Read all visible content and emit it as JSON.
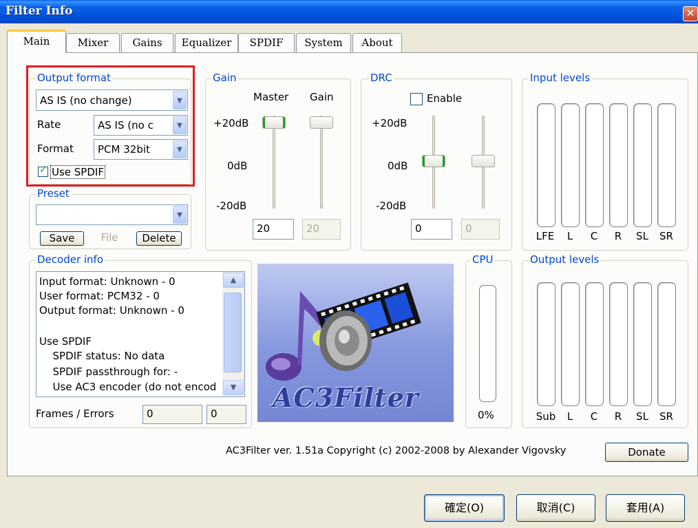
{
  "window": {
    "title": "Filter Info",
    "close_label": "x"
  },
  "tabs": [
    "Main",
    "Mixer",
    "Gains",
    "Equalizer",
    "SPDIF",
    "System",
    "About"
  ],
  "output_format": {
    "label": "Output format",
    "format_value": "AS IS (no change)",
    "rate_label": "Rate",
    "rate_value": "AS IS (no c",
    "format_label": "Format",
    "pcm_value": "PCM 32bit",
    "use_spdif_label": "Use SPDIF",
    "use_spdif_checked": true
  },
  "preset": {
    "label": "Preset",
    "value": "",
    "save": "Save",
    "file": "File",
    "delete": "Delete"
  },
  "gain": {
    "label": "Gain",
    "master_label": "Master",
    "gain_label": "Gain",
    "top_tick": "+20dB",
    "mid_tick": "0dB",
    "bottom_tick": "-20dB",
    "master_value": "20",
    "gain_value": "20"
  },
  "drc": {
    "label": "DRC",
    "enable_label": "Enable",
    "enable_checked": false,
    "top_tick": "+20dB",
    "mid_tick": "0dB",
    "bottom_tick": "-20dB",
    "value1": "0",
    "value2": "0"
  },
  "input_levels": {
    "label": "Input levels",
    "channels": [
      "LFE",
      "L",
      "C",
      "R",
      "SL",
      "SR"
    ]
  },
  "output_levels": {
    "label": "Output levels",
    "channels": [
      "Sub",
      "L",
      "C",
      "R",
      "SL",
      "SR"
    ]
  },
  "decoder_info": {
    "label": "Decoder info",
    "lines": [
      "Input format: Unknown - 0",
      "User format: PCM32 - 0",
      "Output format: Unknown - 0",
      "",
      "Use SPDIF",
      "  SPDIF status: No data",
      "  SPDIF passthrough for: -",
      "  Use AC3 encoder (do not encod"
    ],
    "frames_label": "Frames / Errors",
    "frames_value": "0",
    "errors_value": "0"
  },
  "logo_text": "AC3Filter",
  "cpu": {
    "label": "CPU",
    "value": "0%"
  },
  "footer": {
    "copyright": "AC3Filter ver. 1.51a Copyright (c) 2002-2008 by Alexander Vigovsky",
    "donate": "Donate"
  },
  "dialog_buttons": {
    "ok": "確定(O)",
    "cancel": "取消(C)",
    "apply": "套用(A)"
  },
  "colors": {
    "group_label": "#0046d5",
    "highlight_frame": "#e11b22",
    "slider_accent": "#21a121"
  }
}
